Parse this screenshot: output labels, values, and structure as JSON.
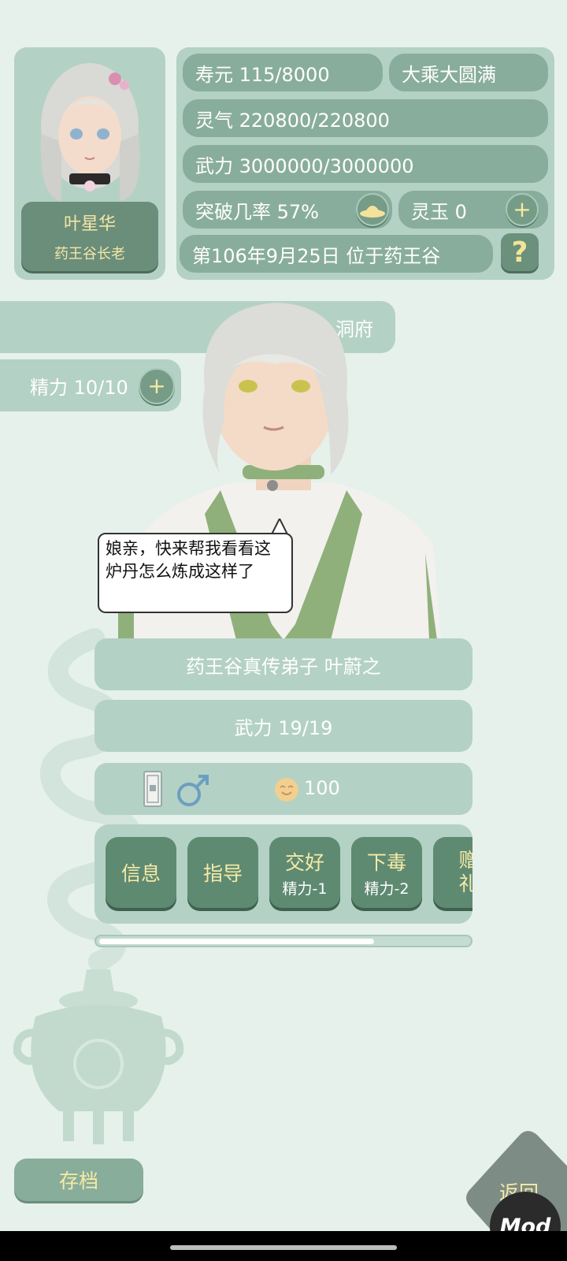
{
  "profile": {
    "name": "叶星华",
    "title": "药王谷长老"
  },
  "stats": {
    "lifespan": "寿元 115/8000",
    "realm": "大乘大圆满",
    "qi": "灵气 220800/220800",
    "force": "武力 3000000/3000000",
    "breakthrough": "突破几率 57%",
    "jade": "灵玉 0",
    "date_location": "第106年9月25日 位于药王谷"
  },
  "tabs": {
    "cave": "洞府",
    "energy": "精力 10/10"
  },
  "speech": "娘亲，快来帮我看看这炉丹怎么炼成这样了",
  "npc": {
    "name": "药王谷真传弟子 叶蔚之",
    "force": "武力 19/19",
    "mood": "100",
    "gender_icon": "male-symbol-icon",
    "talisman_icon": "talisman-icon"
  },
  "actions": [
    {
      "label": "信息",
      "cost": ""
    },
    {
      "label": "指导",
      "cost": ""
    },
    {
      "label": "交好",
      "cost": "精力-1"
    },
    {
      "label": "下毒",
      "cost": "精力-2"
    },
    {
      "label": "赠礼",
      "cost": ""
    }
  ],
  "scroll_position": 0.74,
  "buttons": {
    "save": "存档",
    "return": "返回",
    "mod": "Mod",
    "help": "?",
    "plus": "+"
  },
  "colors": {
    "background": "#e6f1ec",
    "panel": "#b4d1c5",
    "pill": "#89ad9c",
    "button_dark": "#5f8a72",
    "accent_text": "#f6eaa6"
  }
}
